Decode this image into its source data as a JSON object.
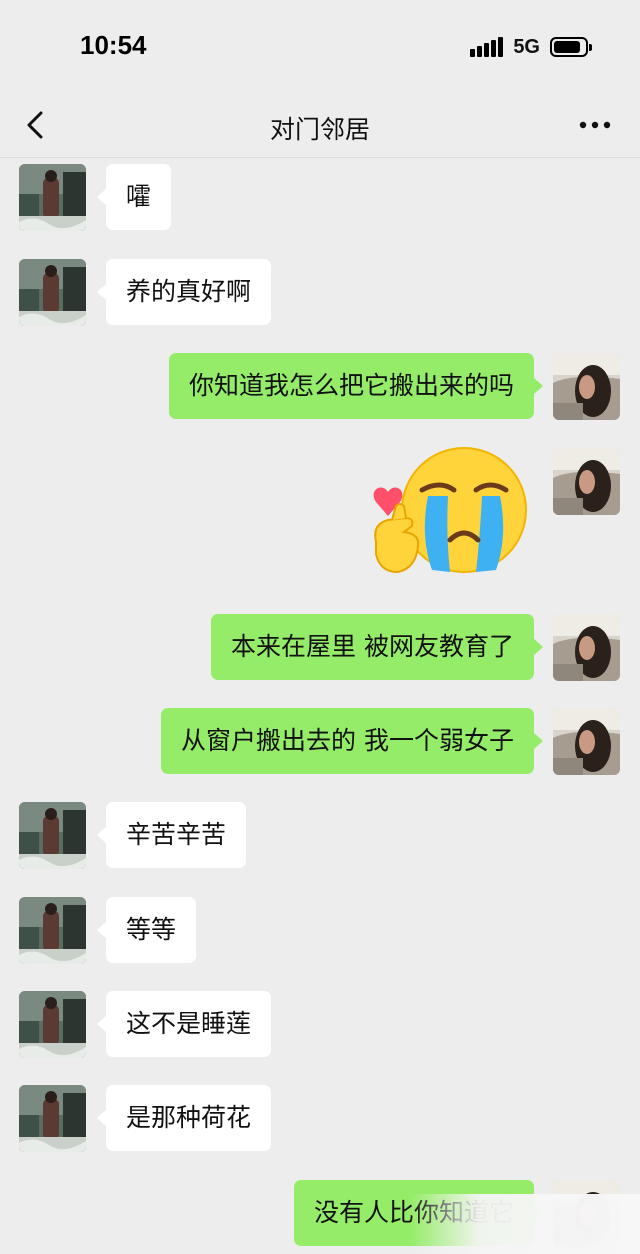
{
  "status_bar": {
    "time": "10:54",
    "network": "5G",
    "battery_level": 0.85
  },
  "nav": {
    "title": "对门邻居",
    "back_icon": "chevron-left-icon",
    "more_icon": "more-horizontal-icon"
  },
  "colors": {
    "background": "#ededed",
    "incoming_bubble": "#ffffff",
    "outgoing_bubble": "#95ec69"
  },
  "messages": [
    {
      "side": "left",
      "type": "text",
      "text": "嚯"
    },
    {
      "side": "left",
      "type": "text",
      "text": "养的真好啊"
    },
    {
      "side": "right",
      "type": "text",
      "text": "你知道我怎么把它搬出来的吗"
    },
    {
      "side": "right",
      "type": "sticker",
      "sticker": "crying-face-finger-heart-sticker"
    },
    {
      "side": "right",
      "type": "text",
      "text": "本来在屋里 被网友教育了"
    },
    {
      "side": "right",
      "type": "text",
      "text": "从窗户搬出去的 我一个弱女子"
    },
    {
      "side": "left",
      "type": "text",
      "text": "辛苦辛苦"
    },
    {
      "side": "left",
      "type": "text",
      "text": "等等"
    },
    {
      "side": "left",
      "type": "text",
      "text": "这不是睡莲"
    },
    {
      "side": "left",
      "type": "text",
      "text": "是那种荷花"
    },
    {
      "side": "right",
      "type": "text",
      "text": "没有人比你知道它"
    }
  ]
}
